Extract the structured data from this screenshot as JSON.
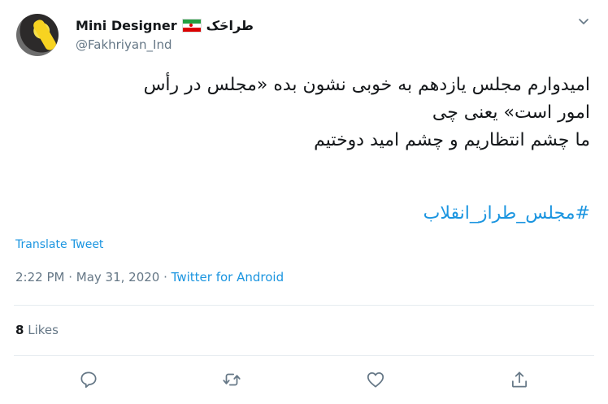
{
  "author": {
    "display_name": "Mini Designer",
    "display_name_fa": "طراحَک",
    "handle": "@Fakhriyan_Ind",
    "flag_icon": "iran-flag-icon"
  },
  "tweet": {
    "lines": [
      "امیدوارم مجلس یازدهم به خوبی نشون بده «مجلس در رأس",
      "امور است» یعنی چی",
      "ما چشم انتظاریم و چشم امید دوختیم"
    ],
    "hashtag": "#مجلس_طراز_انقلاب"
  },
  "translate_label": "Translate Tweet",
  "meta": {
    "time": "2:22 PM",
    "separator1": " · ",
    "date": "May 31, 2020",
    "separator2": " · ",
    "source": "Twitter for Android"
  },
  "likes": {
    "count": "8",
    "label": "Likes"
  },
  "actions": {
    "reply_icon": "reply-icon",
    "retweet_icon": "retweet-icon",
    "like_icon": "heart-icon",
    "share_icon": "share-icon"
  },
  "colors": {
    "link": "#1b95e0",
    "muted": "#657786",
    "text": "#14171a"
  }
}
